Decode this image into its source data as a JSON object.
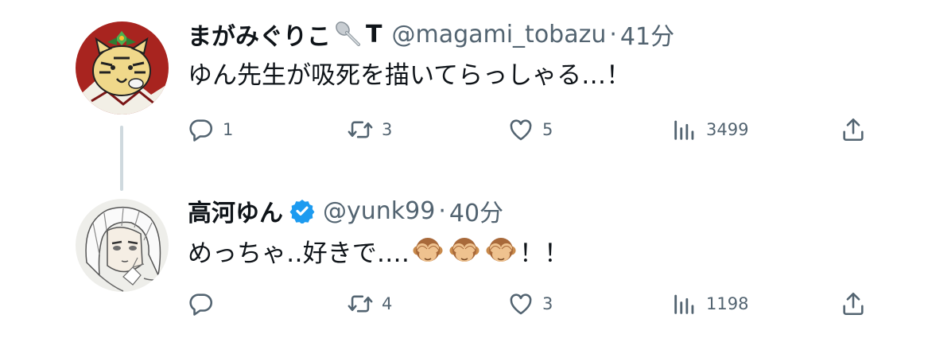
{
  "tweets": [
    {
      "display_name": "まがみぐりこ",
      "name_suffix": "T",
      "handle": "@magami_tobazu",
      "separator": "·",
      "time": "41分",
      "text": "ゆん先生が吸死を描いてらっしゃる…！",
      "verified": false,
      "actions": {
        "replies": "1",
        "retweets": "3",
        "likes": "5",
        "views": "3499"
      }
    },
    {
      "display_name": "高河ゆん",
      "handle": "@yunk99",
      "separator": "·",
      "time": "40分",
      "text": "めっちゃ‥好きで‥‥",
      "text_end": "！！",
      "emoji": [
        "see-no-evil-monkey",
        "see-no-evil-monkey",
        "see-no-evil-monkey"
      ],
      "verified": true,
      "actions": {
        "replies": "",
        "retweets": "4",
        "likes": "3",
        "views": "1198"
      }
    }
  ],
  "colors": {
    "text": "#0f1419",
    "secondary": "#536471",
    "thread_line": "#cfd9de",
    "verified": "#1d9bf0"
  }
}
